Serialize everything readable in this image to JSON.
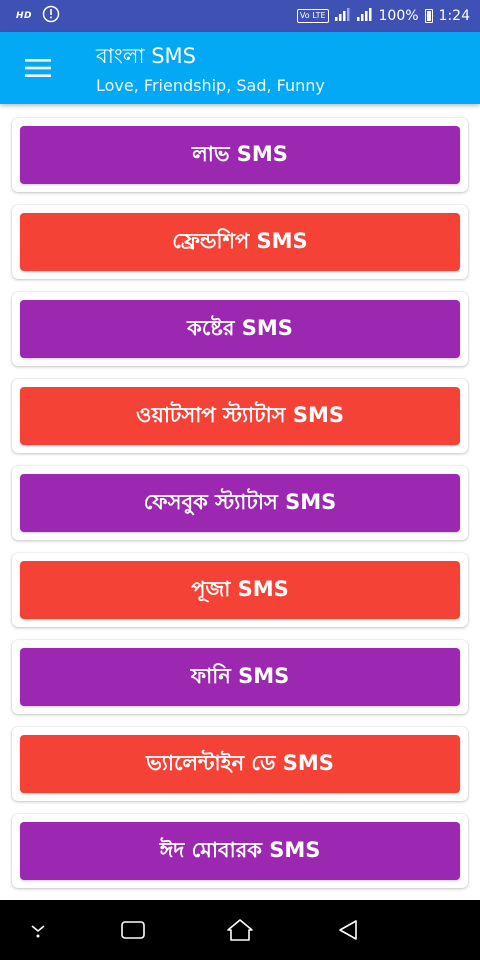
{
  "status_bar": {
    "hd_label": "HD",
    "network_label": "Vo LTE",
    "battery_text": "100%",
    "time": "1:24",
    "icons": [
      "info-icon",
      "signal-icon",
      "battery-icon"
    ]
  },
  "app_bar": {
    "title": "বাংলা SMS",
    "subtitle": "Love, Friendship, Sad, Funny",
    "menu_icon": "hamburger-menu-icon",
    "color": "#03a9f4"
  },
  "colors": {
    "purple": "#9c27b0",
    "red": "#f44336",
    "status_bar": "#3f51b5"
  },
  "categories": [
    {
      "label": "লাভ SMS",
      "color": "#9c27b0"
    },
    {
      "label": "ফ্রেন্ডশিপ SMS",
      "color": "#f44336"
    },
    {
      "label": "কষ্টের SMS",
      "color": "#9c27b0"
    },
    {
      "label": "ওয়াটসাপ স্ট্যাটাস SMS",
      "color": "#f44336"
    },
    {
      "label": "ফেসবুক স্ট্যাটাস SMS",
      "color": "#9c27b0"
    },
    {
      "label": "পূজা SMS",
      "color": "#f44336"
    },
    {
      "label": "ফানি SMS",
      "color": "#9c27b0"
    },
    {
      "label": "ভ্যালেন্টাইন ডে SMS",
      "color": "#f44336"
    },
    {
      "label": "ঈদ মোবারক SMS",
      "color": "#9c27b0"
    }
  ],
  "nav_bar": {
    "icons": [
      "notification-pull-icon",
      "recents-icon",
      "home-icon",
      "back-icon"
    ]
  }
}
